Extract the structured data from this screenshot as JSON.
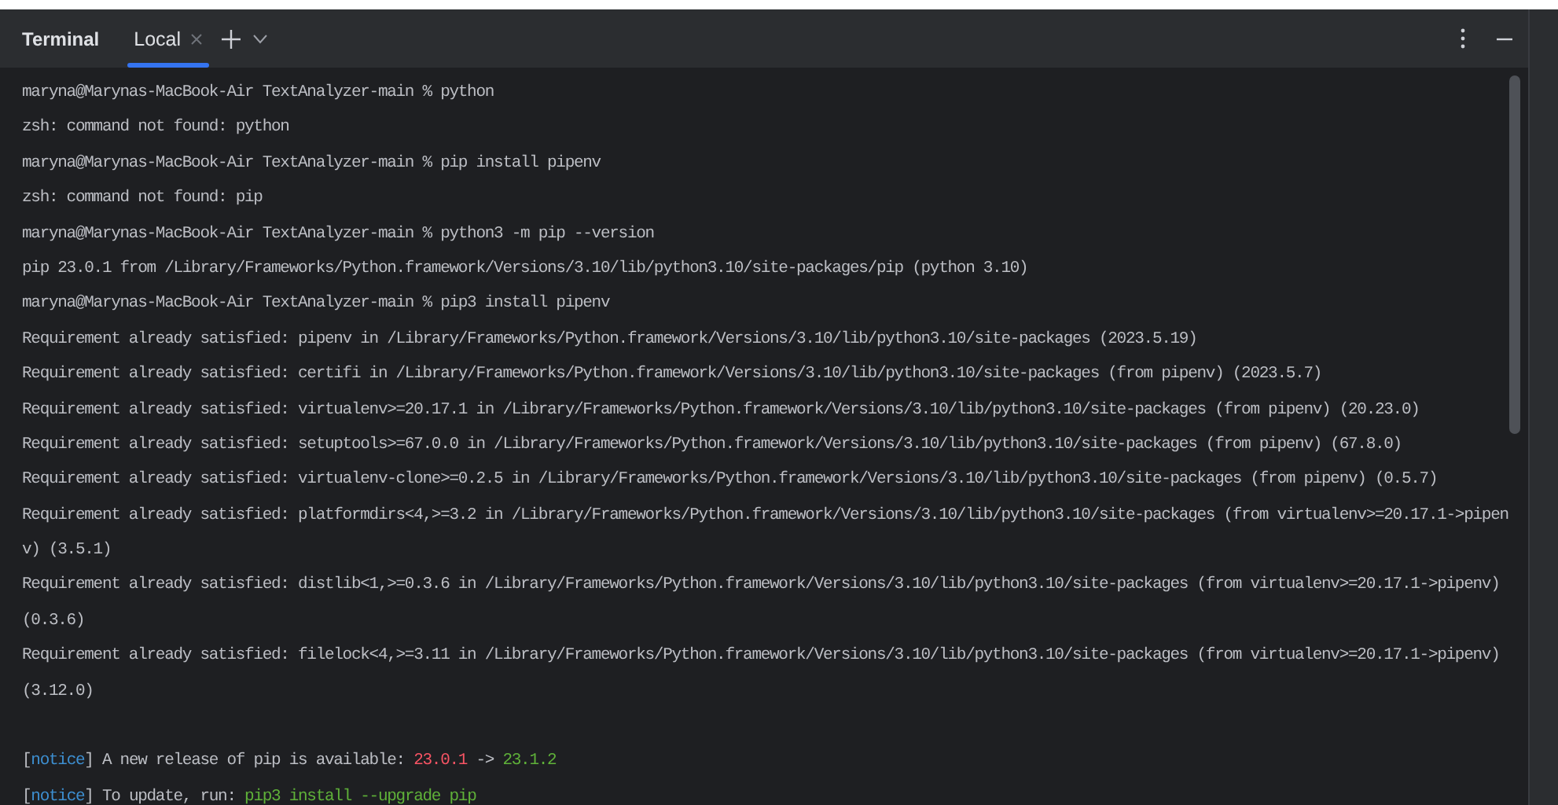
{
  "panel": {
    "title": "Terminal",
    "tabs": [
      {
        "label": "Local",
        "selected": true
      }
    ]
  },
  "lines": [
    {
      "kind": "text",
      "segments": [
        {
          "kind": "plain",
          "text": "maryna@Marynas-MacBook-Air TextAnalyzer-main % python"
        }
      ]
    },
    {
      "kind": "text",
      "segments": [
        {
          "kind": "plain",
          "text": "zsh: command not found: python"
        }
      ]
    },
    {
      "kind": "text",
      "segments": [
        {
          "kind": "plain",
          "text": "maryna@Marynas-MacBook-Air TextAnalyzer-main % pip install pipenv"
        }
      ]
    },
    {
      "kind": "text",
      "segments": [
        {
          "kind": "plain",
          "text": "zsh: command not found: pip"
        }
      ]
    },
    {
      "kind": "text",
      "segments": [
        {
          "kind": "plain",
          "text": "maryna@Marynas-MacBook-Air TextAnalyzer-main % python3 -m pip --version"
        }
      ]
    },
    {
      "kind": "text",
      "segments": [
        {
          "kind": "plain",
          "text": "pip 23.0.1 from /Library/Frameworks/Python.framework/Versions/3.10/lib/python3.10/site-packages/pip (python 3.10)"
        }
      ]
    },
    {
      "kind": "text",
      "segments": [
        {
          "kind": "plain",
          "text": "maryna@Marynas-MacBook-Air TextAnalyzer-main % pip3 install pipenv"
        }
      ]
    },
    {
      "kind": "text",
      "segments": [
        {
          "kind": "plain",
          "text": "Requirement already satisfied: pipenv in /Library/Frameworks/Python.framework/Versions/3.10/lib/python3.10/site-packages (2023.5.19)"
        }
      ]
    },
    {
      "kind": "text",
      "segments": [
        {
          "kind": "plain",
          "text": "Requirement already satisfied: certifi in /Library/Frameworks/Python.framework/Versions/3.10/lib/python3.10/site-packages (from pipenv) (2023.5.7)"
        }
      ]
    },
    {
      "kind": "text",
      "segments": [
        {
          "kind": "plain",
          "text": "Requirement already satisfied: virtualenv>=20.17.1 in /Library/Frameworks/Python.framework/Versions/3.10/lib/python3.10/site-packages (from pipenv) (20.23.0)"
        }
      ]
    },
    {
      "kind": "text",
      "segments": [
        {
          "kind": "plain",
          "text": "Requirement already satisfied: setuptools>=67.0.0 in /Library/Frameworks/Python.framework/Versions/3.10/lib/python3.10/site-packages (from pipenv) (67.8.0)"
        }
      ]
    },
    {
      "kind": "text",
      "segments": [
        {
          "kind": "plain",
          "text": "Requirement already satisfied: virtualenv-clone>=0.2.5 in /Library/Frameworks/Python.framework/Versions/3.10/lib/python3.10/site-packages (from pipenv) (0.5.7)"
        }
      ]
    },
    {
      "kind": "text",
      "segments": [
        {
          "kind": "plain",
          "text": "Requirement already satisfied: platformdirs<4,>=3.2 in /Library/Frameworks/Python.framework/Versions/3.10/lib/python3.10/site-packages (from virtualenv>=20.17.1->pipen"
        }
      ]
    },
    {
      "kind": "text",
      "segments": [
        {
          "kind": "plain",
          "text": "v) (3.5.1)"
        }
      ]
    },
    {
      "kind": "text",
      "segments": [
        {
          "kind": "plain",
          "text": "Requirement already satisfied: distlib<1,>=0.3.6 in /Library/Frameworks/Python.framework/Versions/3.10/lib/python3.10/site-packages (from virtualenv>=20.17.1->pipenv)"
        }
      ]
    },
    {
      "kind": "text",
      "segments": [
        {
          "kind": "plain",
          "text": "(0.3.6)"
        }
      ]
    },
    {
      "kind": "text",
      "segments": [
        {
          "kind": "plain",
          "text": "Requirement already satisfied: filelock<4,>=3.11 in /Library/Frameworks/Python.framework/Versions/3.10/lib/python3.10/site-packages (from virtualenv>=20.17.1->pipenv)"
        }
      ]
    },
    {
      "kind": "text",
      "segments": [
        {
          "kind": "plain",
          "text": "(3.12.0)"
        }
      ]
    },
    {
      "kind": "blank"
    },
    {
      "kind": "text",
      "segments": [
        {
          "kind": "plain",
          "text": "["
        },
        {
          "kind": "notice",
          "text": "notice"
        },
        {
          "kind": "plain",
          "text": "] A new release of pip is available: "
        },
        {
          "kind": "old",
          "text": "23.0.1"
        },
        {
          "kind": "plain",
          "text": " -> "
        },
        {
          "kind": "new",
          "text": "23.1.2"
        }
      ]
    },
    {
      "kind": "text",
      "segments": [
        {
          "kind": "plain",
          "text": "["
        },
        {
          "kind": "notice",
          "text": "notice"
        },
        {
          "kind": "plain",
          "text": "] To update, run: "
        },
        {
          "kind": "new",
          "text": "pip3 install --upgrade pip"
        }
      ]
    }
  ]
}
